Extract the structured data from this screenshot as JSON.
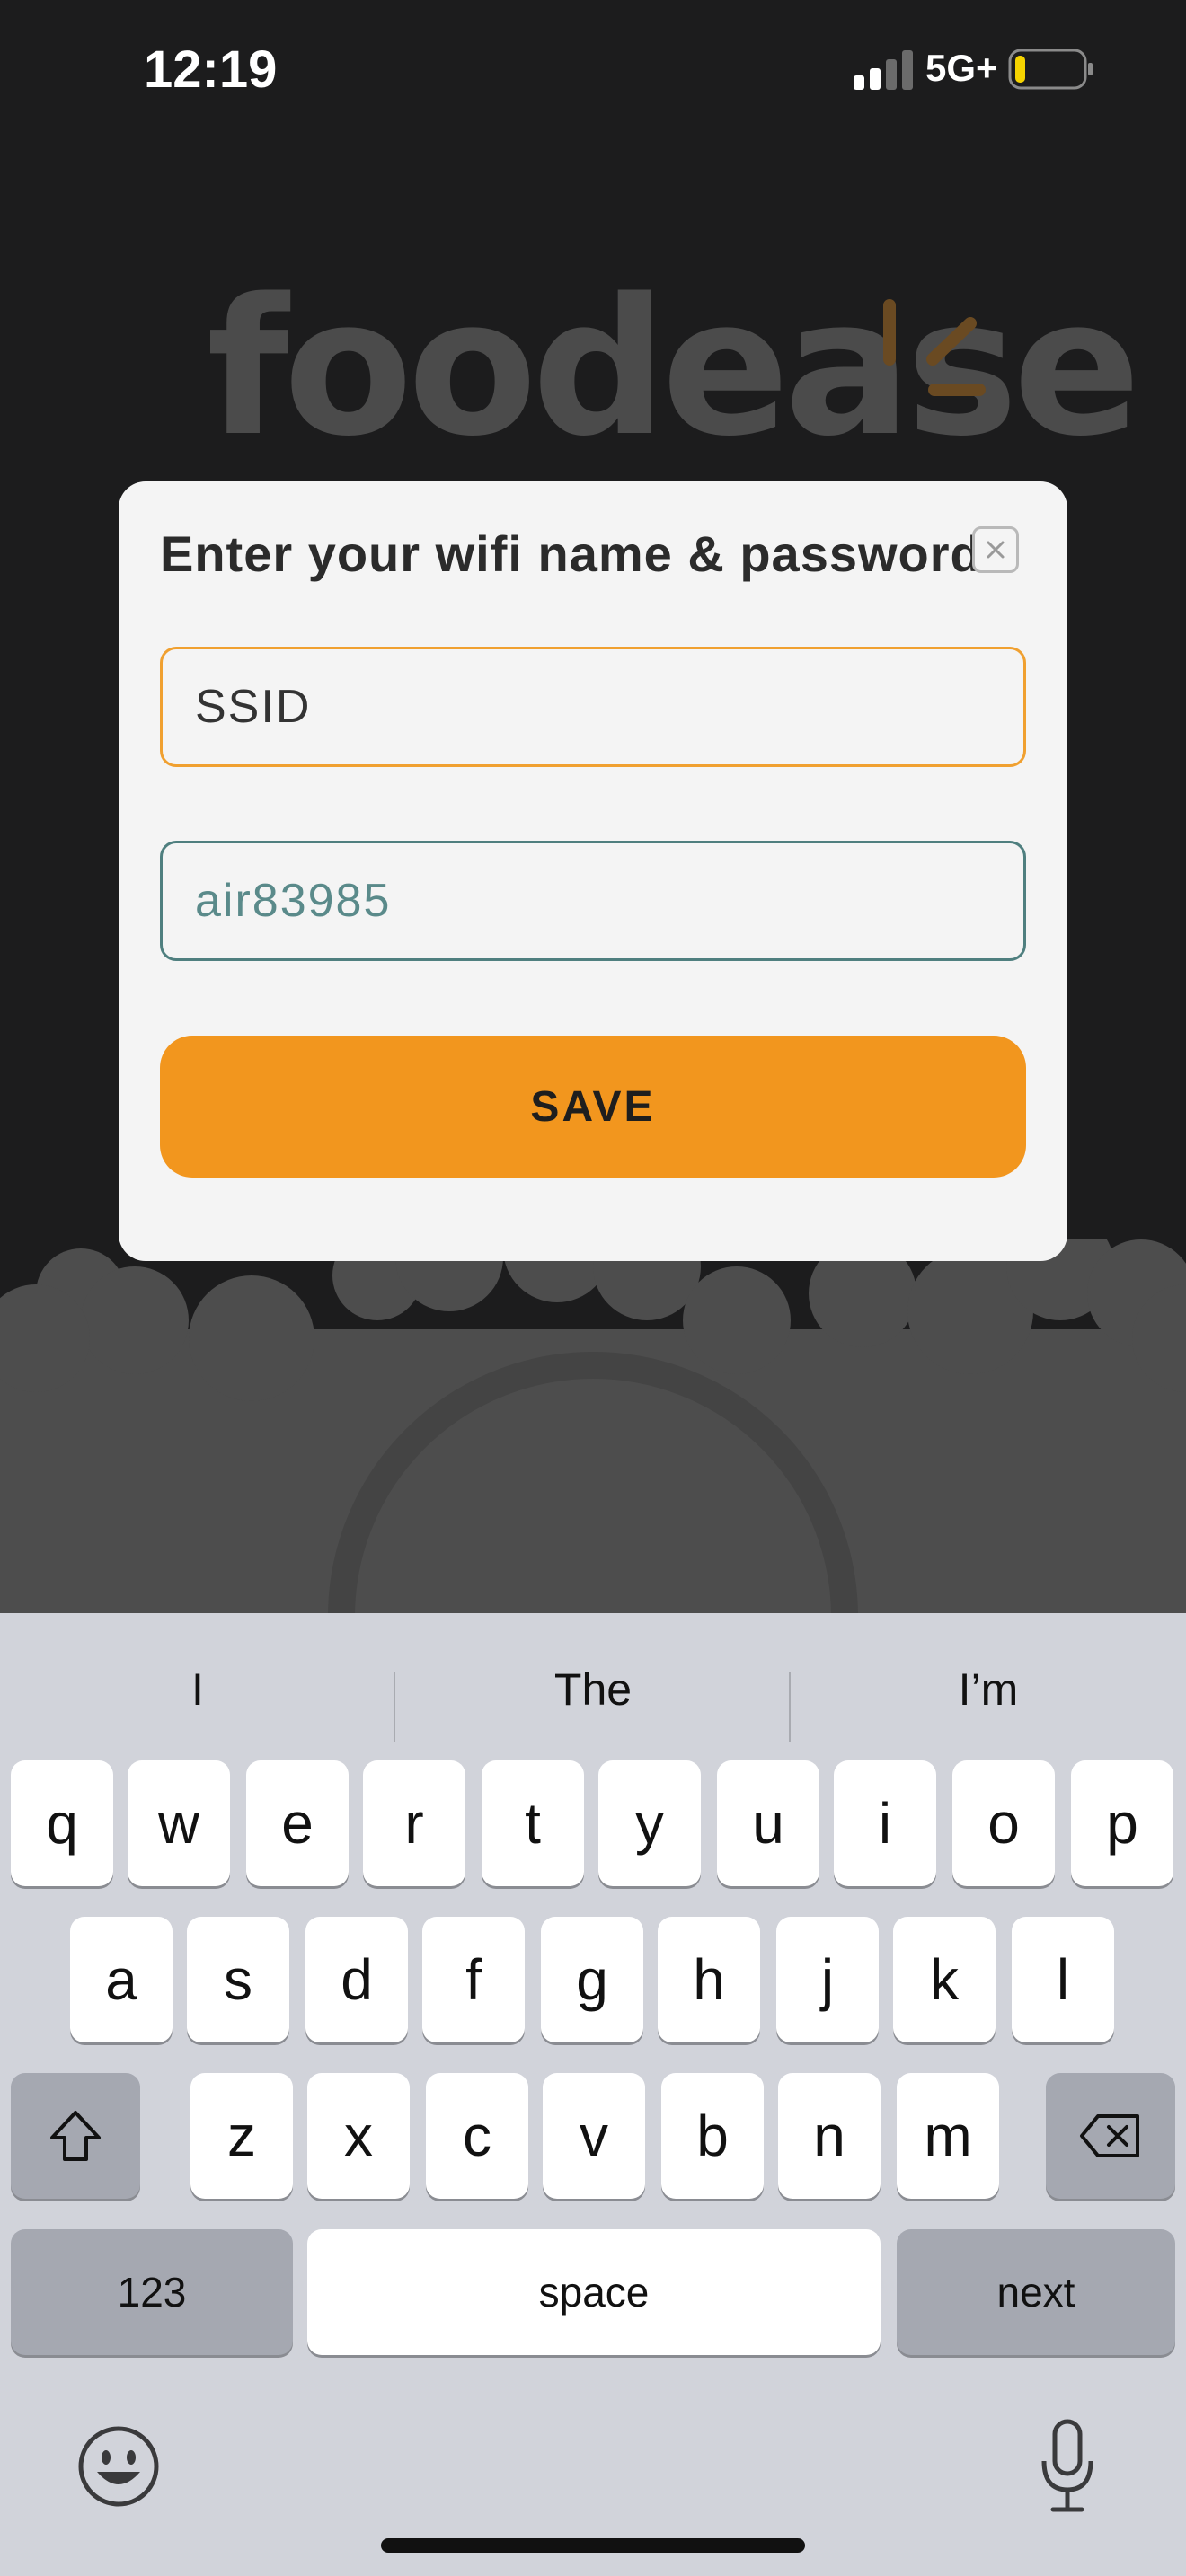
{
  "status_bar": {
    "time": "12:19",
    "network": "5G+",
    "battery_level": 0.15,
    "battery_color": "#f5d300"
  },
  "logo": {
    "text": "foodease",
    "color": "#4b4b4b",
    "accent": "#6a4a22"
  },
  "modal": {
    "title": "Enter your wifi name & password",
    "close_icon": "close-icon",
    "ssid": {
      "value": "SSID"
    },
    "password": {
      "value": "air83985"
    },
    "save_label": "SAVE",
    "accent_color": "#f2961e"
  },
  "keyboard": {
    "suggestions": [
      "I",
      "The",
      "I’m"
    ],
    "row1": [
      "q",
      "w",
      "e",
      "r",
      "t",
      "y",
      "u",
      "i",
      "o",
      "p"
    ],
    "row2": [
      "a",
      "s",
      "d",
      "f",
      "g",
      "h",
      "j",
      "k",
      "l"
    ],
    "row3": [
      "z",
      "x",
      "c",
      "v",
      "b",
      "n",
      "m"
    ],
    "numbers_label": "123",
    "space_label": "space",
    "next_label": "next",
    "shift_icon": "shift-icon",
    "delete_icon": "delete-icon",
    "emoji_icon": "emoji-icon",
    "mic_icon": "microphone-icon"
  }
}
